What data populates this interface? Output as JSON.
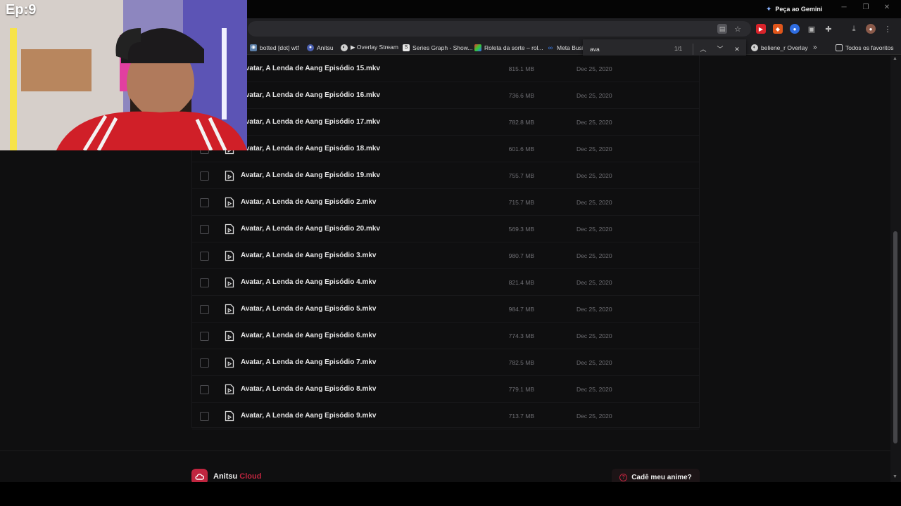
{
  "overlay": {
    "episode_label": "Ep:9"
  },
  "browser": {
    "gemini_button": "Peça ao Gemini",
    "bookmarks": [
      {
        "label": "botted [dot] wtf",
        "icon": "globe-icon"
      },
      {
        "label": "Anitsu",
        "icon": "anitsu-icon"
      },
      {
        "label": "▶ Overlay Stream",
        "icon": "github-icon"
      },
      {
        "label": "Series Graph - Show...",
        "icon": "series-graph-icon"
      },
      {
        "label": "Roleta da sorte – rol...",
        "icon": "wheel-icon"
      },
      {
        "label": "Meta Busin",
        "icon": "meta-icon"
      },
      {
        "label": "beliene_r Overlay",
        "icon": "github-icon"
      },
      {
        "label": "Todos os favoritos",
        "icon": "folder-icon"
      }
    ],
    "find": {
      "query": "ava",
      "count": "1/1"
    }
  },
  "files": [
    {
      "name": "Avatar, A Lenda de Aang Episódio 15.mkv",
      "size": "815.1 MB",
      "date": "Dec 25, 2020"
    },
    {
      "name": "Avatar, A Lenda de Aang Episódio 16.mkv",
      "size": "736.6 MB",
      "date": "Dec 25, 2020"
    },
    {
      "name": "Avatar, A Lenda de Aang Episódio 17.mkv",
      "size": "782.8 MB",
      "date": "Dec 25, 2020"
    },
    {
      "name": "Avatar, A Lenda de Aang Episódio 18.mkv",
      "size": "601.6 MB",
      "date": "Dec 25, 2020"
    },
    {
      "name": "Avatar, A Lenda de Aang Episódio 19.mkv",
      "size": "755.7 MB",
      "date": "Dec 25, 2020"
    },
    {
      "name": "Avatar, A Lenda de Aang Episódio 2.mkv",
      "size": "715.7 MB",
      "date": "Dec 25, 2020"
    },
    {
      "name": "Avatar, A Lenda de Aang Episódio 20.mkv",
      "size": "569.3 MB",
      "date": "Dec 25, 2020"
    },
    {
      "name": "Avatar, A Lenda de Aang Episódio 3.mkv",
      "size": "980.7 MB",
      "date": "Dec 25, 2020"
    },
    {
      "name": "Avatar, A Lenda de Aang Episódio 4.mkv",
      "size": "821.4 MB",
      "date": "Dec 25, 2020"
    },
    {
      "name": "Avatar, A Lenda de Aang Episódio 5.mkv",
      "size": "984.7 MB",
      "date": "Dec 25, 2020"
    },
    {
      "name": "Avatar, A Lenda de Aang Episódio 6.mkv",
      "size": "774.3 MB",
      "date": "Dec 25, 2020"
    },
    {
      "name": "Avatar, A Lenda de Aang Episódio 7.mkv",
      "size": "782.5 MB",
      "date": "Dec 25, 2020"
    },
    {
      "name": "Avatar, A Lenda de Aang Episódio 8.mkv",
      "size": "779.1 MB",
      "date": "Dec 25, 2020"
    },
    {
      "name": "Avatar, A Lenda de Aang Episódio 9.mkv",
      "size": "713.7 MB",
      "date": "Dec 25, 2020"
    }
  ],
  "footer": {
    "logo_main": "Anitsu",
    "logo_accent": "Cloud",
    "anime_button": "Cadê meu anime?"
  },
  "colors": {
    "accent": "#c0253f",
    "background": "#0f0f10"
  }
}
